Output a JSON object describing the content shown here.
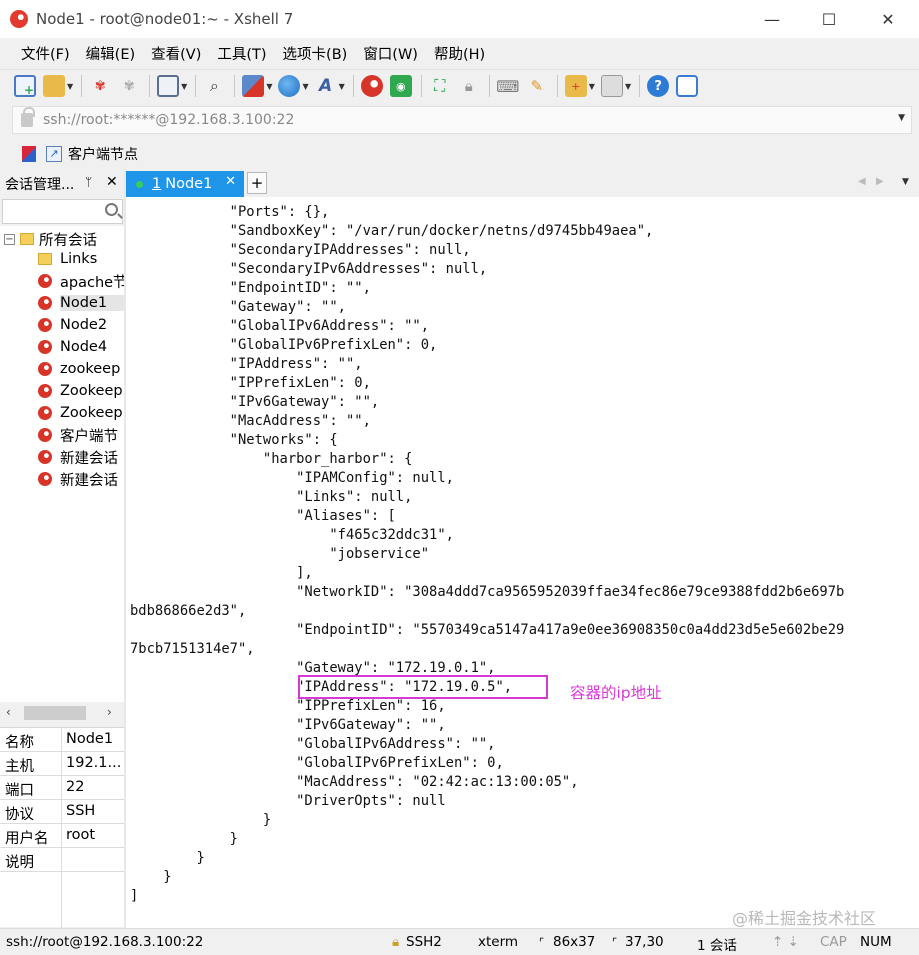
{
  "window": {
    "title": "Node1 - root@node01:~ - Xshell 7",
    "controls": {
      "minimize": "—",
      "maximize": "☐",
      "close": "✕"
    }
  },
  "menu": [
    "文件(F)",
    "编辑(E)",
    "查看(V)",
    "工具(T)",
    "选项卡(B)",
    "窗口(W)",
    "帮助(H)"
  ],
  "address": {
    "url": "ssh://root:******@192.168.3.100:22"
  },
  "links_bar": {
    "quick_link_label": "客户端节点"
  },
  "left_panel": {
    "header": "会话管理...",
    "pin": "ᛘ",
    "close": "✕",
    "tree": {
      "root_label": "所有会话",
      "root_toggle": "−",
      "items": [
        {
          "label": "Links",
          "type": "folder"
        },
        {
          "label": "apache节",
          "type": "session"
        },
        {
          "label": "Node1",
          "type": "session",
          "selected": true
        },
        {
          "label": "Node2",
          "type": "session"
        },
        {
          "label": "Node4",
          "type": "session"
        },
        {
          "label": "zookeep",
          "type": "session"
        },
        {
          "label": "Zookeep",
          "type": "session"
        },
        {
          "label": "Zookeep",
          "type": "session"
        },
        {
          "label": "客户端节",
          "type": "session"
        },
        {
          "label": "新建会话",
          "type": "session"
        },
        {
          "label": "新建会话",
          "type": "session"
        }
      ]
    },
    "scroll": {
      "left": "‹",
      "right": "›"
    },
    "properties": [
      {
        "key": "名称",
        "value": "Node1"
      },
      {
        "key": "主机",
        "value": "192.1..."
      },
      {
        "key": "端口",
        "value": "22"
      },
      {
        "key": "协议",
        "value": "SSH"
      },
      {
        "key": "用户名",
        "value": "root"
      },
      {
        "key": "说明",
        "value": ""
      }
    ]
  },
  "tabs": {
    "active": {
      "number": "1",
      "label": "Node1",
      "close": "✕"
    },
    "add": "+",
    "nav_left": "◀",
    "nav_right": "▶",
    "menu": "▼"
  },
  "terminal": {
    "lines": [
      "            \"Ports\": {},",
      "            \"SandboxKey\": \"/var/run/docker/netns/d9745bb49aea\",",
      "            \"SecondaryIPAddresses\": null,",
      "            \"SecondaryIPv6Addresses\": null,",
      "            \"EndpointID\": \"\",",
      "            \"Gateway\": \"\",",
      "            \"GlobalIPv6Address\": \"\",",
      "            \"GlobalIPv6PrefixLen\": 0,",
      "            \"IPAddress\": \"\",",
      "            \"IPPrefixLen\": 0,",
      "            \"IPv6Gateway\": \"\",",
      "            \"MacAddress\": \"\",",
      "            \"Networks\": {",
      "                \"harbor_harbor\": {",
      "                    \"IPAMConfig\": null,",
      "                    \"Links\": null,",
      "                    \"Aliases\": [",
      "                        \"f465c32ddc31\",",
      "                        \"jobservice\"",
      "                    ],",
      "                    \"NetworkID\": \"308a4ddd7ca9565952039ffae34fec86e79ce9388fdd2b6e697b",
      "bdb86866e2d3\",",
      "                    \"EndpointID\": \"5570349ca5147a417a9e0ee36908350c0a4dd23d5e5e602be29",
      "7bcb7151314e7\",",
      "                    \"Gateway\": \"172.19.0.1\",",
      "                    \"IPAddress\": \"172.19.0.5\",",
      "                    \"IPPrefixLen\": 16,",
      "                    \"IPv6Gateway\": \"\",",
      "                    \"GlobalIPv6Address\": \"\",",
      "                    \"GlobalIPv6PrefixLen\": 0,",
      "                    \"MacAddress\": \"02:42:ac:13:00:05\",",
      "                    \"DriverOpts\": null",
      "                }",
      "            }",
      "        }",
      "    }",
      "]"
    ],
    "annotation": "容器的ip地址",
    "annotation_color": "#d838d6",
    "watermark": "@稀土掘金技术社区"
  },
  "status": {
    "connection": "ssh://root@192.168.3.100:22",
    "protocol": "SSH2",
    "terminal_type": "xterm",
    "size": "86x37",
    "cursor": "37,30",
    "sessions": "1 会话",
    "nav_arrows": "⇡ ⇣",
    "caps": "CAP",
    "num": "NUM"
  },
  "colors": {
    "tab_active": "#1e95e8",
    "highlight": "#d838d6",
    "status_dot": "#33d05a"
  },
  "toolbar_icons": [
    "new-session-icon",
    "open-folder-icon",
    "reconnect-icon",
    "disconnect-icon",
    "properties-icon",
    "find-icon",
    "transfer-icon",
    "globe-icon",
    "font-icon",
    "xshell-icon",
    "xftp-icon",
    "fullscreen-icon",
    "lock-icon",
    "keyboard-icon",
    "highlight-icon",
    "compose-icon",
    "layout-icon",
    "help-icon",
    "chat-icon"
  ]
}
